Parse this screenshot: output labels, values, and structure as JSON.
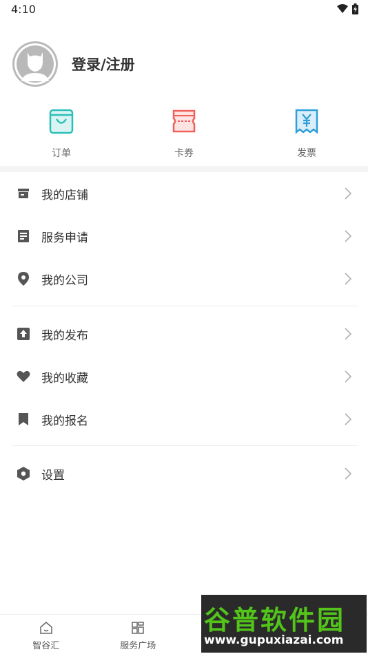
{
  "status_bar": {
    "time": "4:10"
  },
  "profile": {
    "login_label": "登录/注册"
  },
  "quick_actions": [
    {
      "label": "订单",
      "icon": "shopping-bag-icon",
      "color": "#2bbfb8"
    },
    {
      "label": "卡券",
      "icon": "coupon-icon",
      "color": "#f0605a"
    },
    {
      "label": "发票",
      "icon": "invoice-icon",
      "color": "#2e9fd8"
    }
  ],
  "menu_groups": [
    [
      {
        "label": "我的店铺",
        "icon": "store-icon"
      },
      {
        "label": "服务申请",
        "icon": "document-icon"
      },
      {
        "label": "我的公司",
        "icon": "location-pin-icon"
      }
    ],
    [
      {
        "label": "我的发布",
        "icon": "upload-icon"
      },
      {
        "label": "我的收藏",
        "icon": "heart-icon"
      },
      {
        "label": "我的报名",
        "icon": "bookmark-icon"
      }
    ],
    [
      {
        "label": "设置",
        "icon": "settings-icon"
      }
    ]
  ],
  "tabbar": [
    {
      "label": "智谷汇",
      "icon": "home-icon"
    },
    {
      "label": "服务广场",
      "icon": "grid-icon"
    },
    {
      "label": "",
      "icon": "tab-icon"
    },
    {
      "label": "",
      "icon": "profile-icon"
    }
  ],
  "watermark": {
    "title": "谷普软件园",
    "url": "www.gupuxiazai.com"
  },
  "colors": {
    "icon_gray": "#555555",
    "chevron": "#b0b0b0",
    "watermark_green": "#52c41a"
  }
}
